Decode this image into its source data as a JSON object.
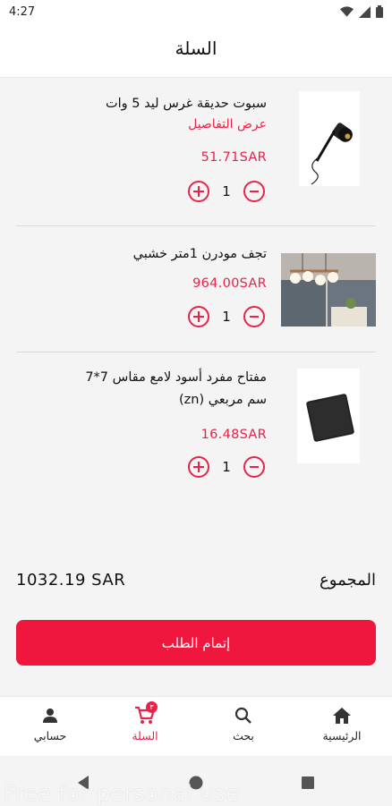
{
  "status_bar": {
    "time": "4:27"
  },
  "header": {
    "title": "السلة"
  },
  "cart": {
    "items": [
      {
        "name": "سبوت حديقة غرس ليد 5 وات",
        "details_link": "عرض التفاصيل",
        "price": "51.71SAR",
        "quantity": "1",
        "image": "garden-spot-light"
      },
      {
        "name": "تجف مودرن 1متر خشبي",
        "price": "964.00SAR",
        "quantity": "1",
        "image": "wooden-chandelier"
      },
      {
        "name_line1": "مفتاح مفرد أسود لامع مقاس 7*7",
        "name_line2": "سم مربعي (zn)",
        "price": "16.48SAR",
        "quantity": "1",
        "image": "black-switch"
      }
    ],
    "total_label": "المجموع",
    "total_value": "1032.19 SAR",
    "checkout_label": "إتمام الطلب"
  },
  "bottom_nav": {
    "items": [
      {
        "label": "الرئيسية",
        "icon": "home-icon"
      },
      {
        "label": "بحث",
        "icon": "search-icon"
      },
      {
        "label": "السلة",
        "icon": "cart-icon",
        "badge": "٣",
        "active": true
      },
      {
        "label": "حسابي",
        "icon": "person-icon"
      }
    ]
  },
  "watermark": "Free for personal use",
  "colors": {
    "accent": "#e8234a",
    "button": "#f0173f",
    "background": "#f4f4f4"
  }
}
